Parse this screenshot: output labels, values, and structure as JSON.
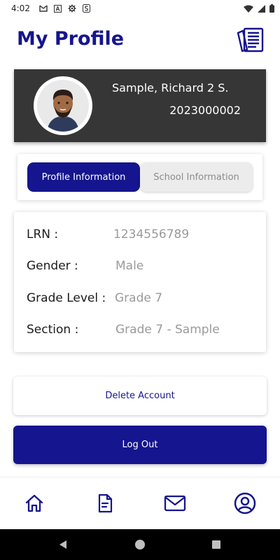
{
  "status_bar": {
    "time": "4:02",
    "icons": [
      "gmail-icon",
      "font-a-icon",
      "settings-icon",
      "s-icon",
      "wifi-icon",
      "cell-signal-icon",
      "battery-icon"
    ]
  },
  "header": {
    "title": "My Profile",
    "icon": "newspaper-icon"
  },
  "profile": {
    "name": "Sample, Richard 2 S.",
    "id": "2023000002"
  },
  "tabs": {
    "active_label": "Profile Information",
    "inactive_label": "School Information"
  },
  "info": {
    "rows": [
      {
        "label": "LRN :",
        "value": "1234556789"
      },
      {
        "label": "Gender :",
        "value": "Male"
      },
      {
        "label": "Grade Level :",
        "value": "Grade 7"
      },
      {
        "label": "Section :",
        "value": "Grade 7 - Sample"
      }
    ]
  },
  "actions": {
    "delete_label": "Delete Account",
    "logout_label": "Log Out"
  },
  "bottom_nav": {
    "items": [
      "home-icon",
      "document-icon",
      "mail-icon",
      "profile-icon"
    ],
    "active": "profile-icon"
  },
  "colors": {
    "primary": "#15158f",
    "card_dark": "#363636",
    "value_gray": "#9a9a9a"
  }
}
